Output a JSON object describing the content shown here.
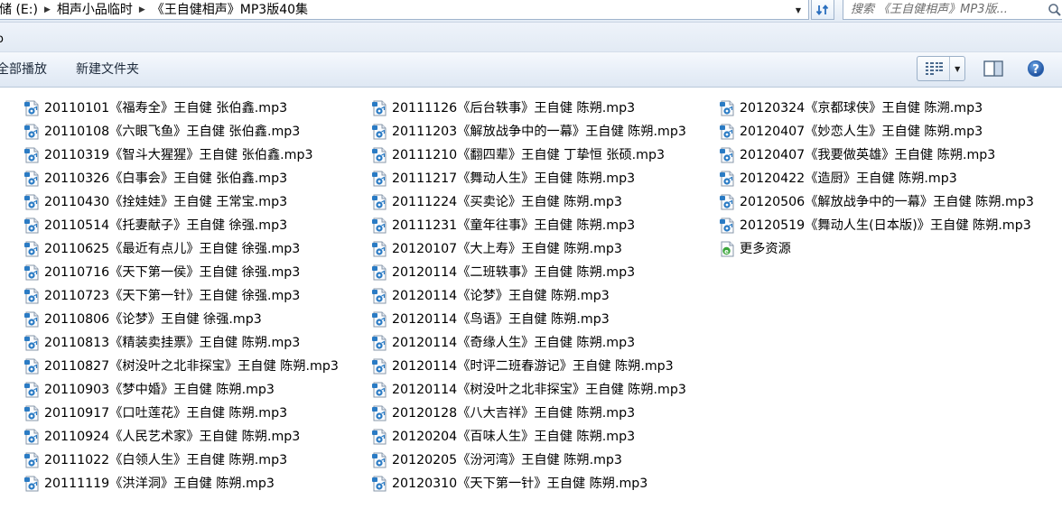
{
  "address": {
    "crumbs": [
      "储 (E:)",
      "相声小品临时",
      "《王自健相声》MP3版40集"
    ]
  },
  "search": {
    "placeholder": "搜索 《王自健相声》MP3版..."
  },
  "toolbar": {
    "play_all": "全部播放",
    "new_folder": "新建文件夹"
  },
  "files": [
    "20110101《福寿全》王自健 张伯鑫.mp3",
    "20110108《六眼飞鱼》王自健 张伯鑫.mp3",
    "20110319《智斗大猩猩》王自健 张伯鑫.mp3",
    "20110326《白事会》王自健 张伯鑫.mp3",
    "20110430《拴娃娃》王自健 王常宝.mp3",
    "20110514《托妻献子》王自健 徐强.mp3",
    "20110625《最近有点儿》王自健 徐强.mp3",
    "20110716《天下第一侯》王自健 徐强.mp3",
    "20110723《天下第一针》王自健 徐强.mp3",
    "20110806《论梦》王自健 徐强.mp3",
    "20110813《精装卖挂票》王自健 陈朔.mp3",
    "20110827《树没叶之北非探宝》王自健 陈朔.mp3",
    "20110903《梦中婚》王自健 陈朔.mp3",
    "20110917《口吐莲花》王自健 陈朔.mp3",
    "20110924《人民艺术家》王自健 陈朔.mp3",
    "20111022《白领人生》王自健 陈朔.mp3",
    "20111119《洪洋洞》王自健 陈朔.mp3",
    "20111126《后台轶事》王自健 陈朔.mp3",
    "20111203《解放战争中的一幕》王自健 陈朔.mp3",
    "20111210《翻四辈》王自健 丁挚恒 张硕.mp3",
    "20111217《舞动人生》王自健 陈朔.mp3",
    "20111224《买卖论》王自健 陈朔.mp3",
    "20111231《童年往事》王自健 陈朔.mp3",
    "20120107《大上寿》王自健 陈朔.mp3",
    "20120114《二班轶事》王自健 陈朔.mp3",
    "20120114《论梦》王自健 陈朔.mp3",
    "20120114《鸟语》王自健 陈朔.mp3",
    "20120114《奇缘人生》王自健 陈朔.mp3",
    "20120114《时评二班春游记》王自健 陈朔.mp3",
    "20120114《树没叶之北非探宝》王自健 陈朔.mp3",
    "20120128《八大吉祥》王自健 陈朔.mp3",
    "20120204《百味人生》王自健 陈朔.mp3",
    "20120205《汾河湾》王自健 陈朔.mp3",
    "20120310《天下第一针》王自健 陈朔.mp3",
    "20120324《京都球侠》王自健 陈溯.mp3",
    "20120407《妙恋人生》王自健 陈朔.mp3",
    "20120407《我要做英雄》王自健 陈朔.mp3",
    "20120422《造厨》王自健 陈朔.mp3",
    "20120506《解放战争中的一幕》王自健 陈朔.mp3",
    "20120519《舞动人生(日本版)》王自健 陈朔.mp3",
    "更多资源"
  ],
  "colors": {
    "icon_blue": "#2a7bc4",
    "icon_green": "#3aa53a"
  }
}
